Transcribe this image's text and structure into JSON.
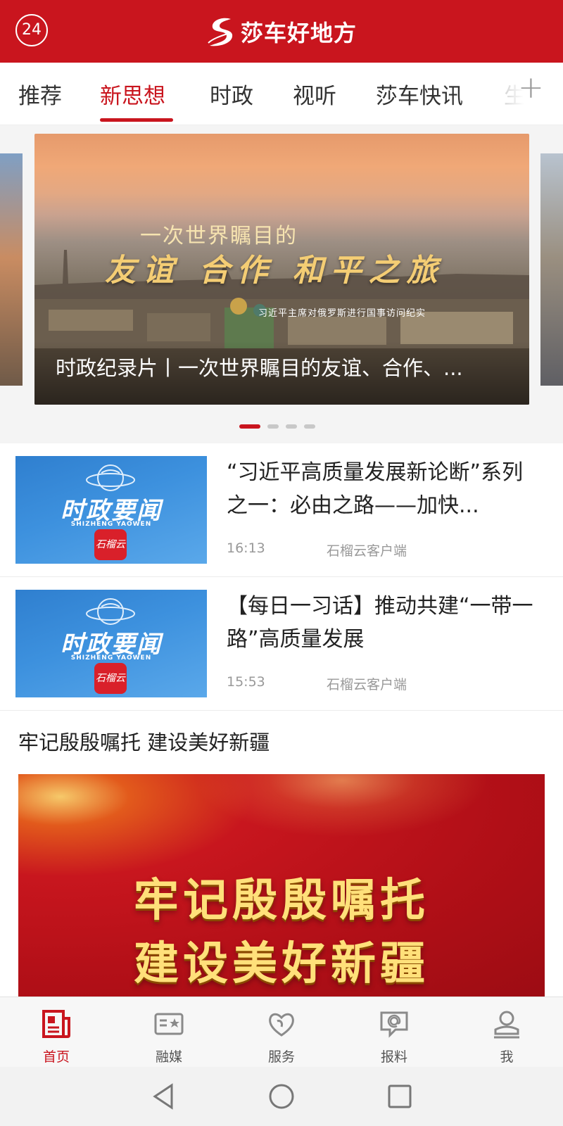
{
  "header": {
    "badge": "24",
    "app_name": "莎车好地方",
    "brand_color": "#c9151e"
  },
  "tabs": [
    {
      "label": "推荐",
      "active": false
    },
    {
      "label": "新思想",
      "active": true
    },
    {
      "label": "时政",
      "active": false
    },
    {
      "label": "视听",
      "active": false
    },
    {
      "label": "莎车快讯",
      "active": false
    },
    {
      "label": "生活",
      "active": false
    }
  ],
  "tabs_more_icon": "plus-icon",
  "carousel": {
    "slide": {
      "overlay_line1": "一次世界瞩目的",
      "overlay_line2": "友谊 合作 和平之旅",
      "overlay_line3": "习近平主席对俄罗斯进行国事访问纪实",
      "caption": "时政纪录片丨一次世界瞩目的友谊、合作、..."
    },
    "dots_total": 4,
    "active_dot": 1
  },
  "news": [
    {
      "thumb_title": "时政要闻",
      "thumb_subtitle": "SHIZHENG YAOWEN",
      "thumb_logo": "石榴云",
      "title": "“习近平高质量发展新论断”系列之一：必由之路——加快...",
      "time": "16:13",
      "source": "石榴云客户端"
    },
    {
      "thumb_title": "时政要闻",
      "thumb_subtitle": "SHIZHENG YAOWEN",
      "thumb_logo": "石榴云",
      "title": "【每日一习话】推动共建“一带一路”高质量发展",
      "time": "15:53",
      "source": "石榴云客户端"
    }
  ],
  "section": {
    "title": "牢记殷殷嘱托 建设美好新疆",
    "banner_line1": "牢记殷殷嘱托",
    "banner_line2": "建设美好新疆"
  },
  "bottom_nav": [
    {
      "label": "首页",
      "icon": "news-icon",
      "active": true
    },
    {
      "label": "融媒",
      "icon": "media-icon",
      "active": false
    },
    {
      "label": "服务",
      "icon": "heart-hands-icon",
      "active": false
    },
    {
      "label": "报料",
      "icon": "report-chat-icon",
      "active": false
    },
    {
      "label": "我",
      "icon": "user-icon",
      "active": false
    }
  ],
  "system_nav": [
    "back",
    "home",
    "recents"
  ]
}
